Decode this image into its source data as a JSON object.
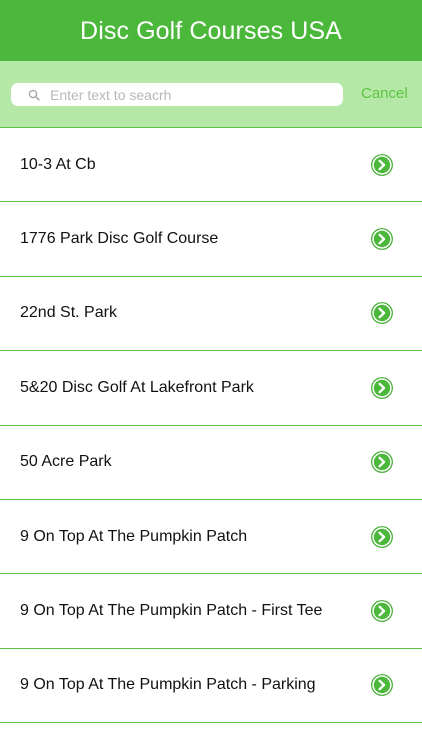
{
  "header": {
    "title": "Disc Golf Courses USA"
  },
  "search": {
    "placeholder": "Enter text to seacrh",
    "value": "",
    "icon": "search-icon",
    "cancel_label": "Cancel"
  },
  "colors": {
    "nav_bar": "#4cb83b",
    "search_bar": "#b5e8a6",
    "accent": "#5cc443",
    "divider": "#5cbf48"
  },
  "courses": [
    {
      "name": "10-3 At Cb",
      "icon": "chevron-right-circle-icon"
    },
    {
      "name": "1776 Park Disc Golf Course",
      "icon": "chevron-right-circle-icon"
    },
    {
      "name": "22nd St. Park",
      "icon": "chevron-right-circle-icon"
    },
    {
      "name": "5&20 Disc Golf At Lakefront Park",
      "icon": "chevron-right-circle-icon"
    },
    {
      "name": "50 Acre Park",
      "icon": "chevron-right-circle-icon"
    },
    {
      "name": "9 On Top At The Pumpkin Patch",
      "icon": "chevron-right-circle-icon"
    },
    {
      "name": "9 On Top At The Pumpkin Patch - First Tee",
      "icon": "chevron-right-circle-icon"
    },
    {
      "name": "9 On Top At The Pumpkin Patch - Parking",
      "icon": "chevron-right-circle-icon"
    }
  ]
}
